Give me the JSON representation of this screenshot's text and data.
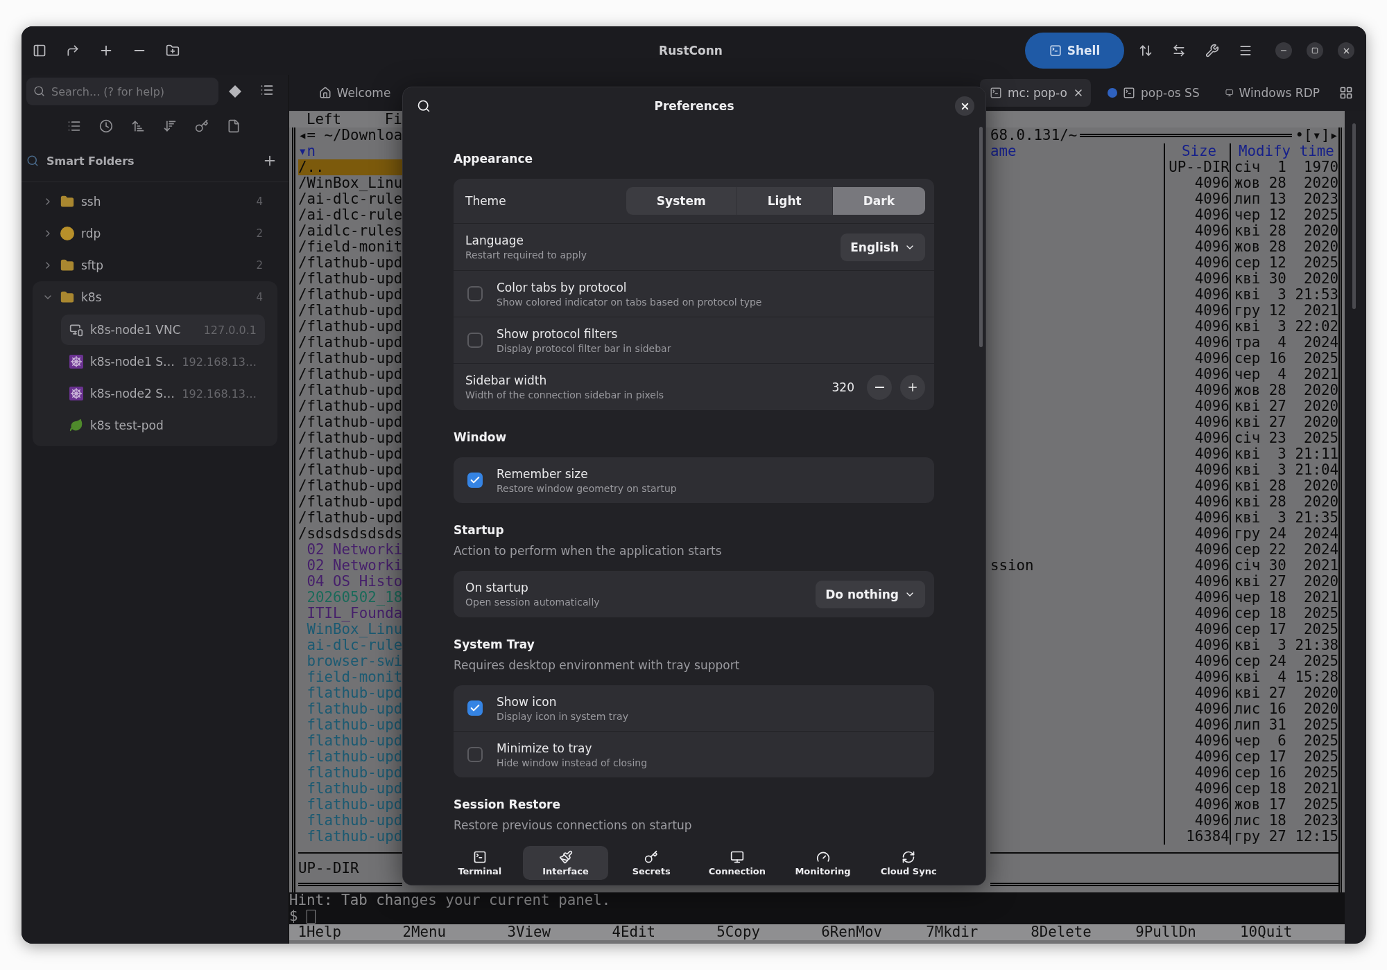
{
  "header": {
    "title": "RustConn",
    "shell_button": "Shell"
  },
  "sidebar": {
    "search": {
      "placeholder": "Search... (? for help)"
    },
    "smart_folders": {
      "title": "Smart Folders"
    },
    "tree": [
      {
        "label": "ssh",
        "count": "4",
        "kind": "folder",
        "expanded": false
      },
      {
        "label": "rdp",
        "count": "2",
        "kind": "emoji",
        "expanded": false
      },
      {
        "label": "sftp",
        "count": "2",
        "kind": "folder",
        "expanded": false
      },
      {
        "label": "k8s",
        "count": "4",
        "kind": "folder",
        "expanded": true,
        "children": [
          {
            "label": "k8s-node1 VNC",
            "host": "127.0.0.1",
            "kind": "vnc",
            "selected": true
          },
          {
            "label": "k8s-node1 S…",
            "host": "192.168.13…",
            "kind": "cluster",
            "selected": false
          },
          {
            "label": "k8s-node2 S…",
            "host": "192.168.13…",
            "kind": "cluster",
            "selected": false
          },
          {
            "label": "k8s test-pod",
            "kind": "pod",
            "selected": false
          }
        ]
      }
    ]
  },
  "tabs": [
    {
      "label": "Welcome",
      "kind": "home",
      "selected": false,
      "dot": false
    },
    {
      "label": "mc: pop-o",
      "kind": "terminal",
      "selected": true,
      "dot": false
    },
    {
      "label": "pop-os SS",
      "kind": "terminal",
      "selected": false,
      "dot": true
    },
    {
      "label": "Windows RDP",
      "kind": "remote",
      "selected": false,
      "dot": false
    }
  ],
  "terminal": {
    "menubar": [
      "Left",
      "Fi"
    ],
    "left_panel": {
      "path": "◂= ~/Downloa",
      "sort_header": "▾n",
      "status": "UP--DIR",
      "rows": [
        {
          "name": "/..",
          "kind": "updir",
          "selected": true
        },
        {
          "name": "/WinBox_Linu",
          "kind": "dir",
          "selected": false
        },
        {
          "name": "/ai-dlc-rule",
          "kind": "dir",
          "selected": false
        },
        {
          "name": "/ai-dlc-rule",
          "kind": "dir",
          "selected": false
        },
        {
          "name": "/aidlc-rules",
          "kind": "dir",
          "selected": false
        },
        {
          "name": "/field-monit",
          "kind": "dir",
          "selected": false
        },
        {
          "name": "/flathub-upd",
          "kind": "dir",
          "selected": false
        },
        {
          "name": "/flathub-upd",
          "kind": "dir",
          "selected": false
        },
        {
          "name": "/flathub-upd",
          "kind": "dir",
          "selected": false
        },
        {
          "name": "/flathub-upd",
          "kind": "dir",
          "selected": false
        },
        {
          "name": "/flathub-upd",
          "kind": "dir",
          "selected": false
        },
        {
          "name": "/flathub-upd",
          "kind": "dir",
          "selected": false
        },
        {
          "name": "/flathub-upd",
          "kind": "dir",
          "selected": false
        },
        {
          "name": "/flathub-upd",
          "kind": "dir",
          "selected": false
        },
        {
          "name": "/flathub-upd",
          "kind": "dir",
          "selected": false
        },
        {
          "name": "/flathub-upd",
          "kind": "dir",
          "selected": false
        },
        {
          "name": "/flathub-upd",
          "kind": "dir",
          "selected": false
        },
        {
          "name": "/flathub-upd",
          "kind": "dir",
          "selected": false
        },
        {
          "name": "/flathub-upd",
          "kind": "dir",
          "selected": false
        },
        {
          "name": "/flathub-upd",
          "kind": "dir",
          "selected": false
        },
        {
          "name": "/flathub-upd",
          "kind": "dir",
          "selected": false
        },
        {
          "name": "/flathub-upd",
          "kind": "dir",
          "selected": false
        },
        {
          "name": "/flathub-upd",
          "kind": "dir",
          "selected": false
        },
        {
          "name": "/sdsdsdsdsds",
          "kind": "dir",
          "selected": false
        },
        {
          "name": "02 Networki",
          "kind": "doc",
          "selected": false
        },
        {
          "name": "02 Networki",
          "kind": "doc",
          "selected": false
        },
        {
          "name": "04 OS Histo",
          "kind": "doc",
          "selected": false
        },
        {
          "name": "20260502_18",
          "kind": "media",
          "selected": false
        },
        {
          "name": "ITIL_Founda",
          "kind": "doc",
          "selected": false
        },
        {
          "name": "WinBox_Linu",
          "kind": "archive",
          "selected": false
        },
        {
          "name": "ai-dlc-rule",
          "kind": "archive",
          "selected": false
        },
        {
          "name": "browser-swi",
          "kind": "archive",
          "selected": false
        },
        {
          "name": "field-monit",
          "kind": "archive",
          "selected": false
        },
        {
          "name": "flathub-upd",
          "kind": "archive",
          "selected": false
        },
        {
          "name": "flathub-upd",
          "kind": "archive",
          "selected": false
        },
        {
          "name": "flathub-upd",
          "kind": "archive",
          "selected": false
        },
        {
          "name": "flathub-upd",
          "kind": "archive",
          "selected": false
        },
        {
          "name": "flathub-upd",
          "kind": "archive",
          "selected": false
        },
        {
          "name": "flathub-upd",
          "kind": "archive",
          "selected": false
        },
        {
          "name": "flathub-upd",
          "kind": "archive",
          "selected": false
        },
        {
          "name": "flathub-upd",
          "kind": "archive",
          "selected": false
        },
        {
          "name": "flathub-upd",
          "kind": "archive",
          "selected": false
        },
        {
          "name": "flathub-upd",
          "kind": "archive",
          "selected": false
        }
      ]
    },
    "right_panel": {
      "path": "68.0.131/~",
      "controls": "•[▾]▸",
      "columns": [
        "ame",
        "Size",
        "Modify time"
      ],
      "rows": [
        {
          "size": "UP--DIR",
          "date": "січ  1  1970"
        },
        {
          "size": "4096",
          "date": "жов 28  2020"
        },
        {
          "size": "4096",
          "date": "лип 13  2023"
        },
        {
          "size": "4096",
          "date": "чер 12  2025"
        },
        {
          "size": "4096",
          "date": "кві 28  2020"
        },
        {
          "size": "4096",
          "date": "жов 28  2020"
        },
        {
          "size": "4096",
          "date": "сер 12  2025"
        },
        {
          "size": "4096",
          "date": "кві 30  2020"
        },
        {
          "size": "4096",
          "date": "кві  3 21:53"
        },
        {
          "size": "4096",
          "date": "гру 12  2021"
        },
        {
          "size": "4096",
          "date": "кві  3 22:02"
        },
        {
          "size": "4096",
          "date": "тра  4  2024"
        },
        {
          "size": "4096",
          "date": "сер 16  2025"
        },
        {
          "size": "4096",
          "date": "чер  4  2021"
        },
        {
          "size": "4096",
          "date": "жов 28  2020"
        },
        {
          "size": "4096",
          "date": "кві 27  2020"
        },
        {
          "size": "4096",
          "date": "кві 27  2020"
        },
        {
          "size": "4096",
          "date": "січ 23  2025"
        },
        {
          "size": "4096",
          "date": "кві  3 21:11"
        },
        {
          "size": "4096",
          "date": "кві  3 21:04"
        },
        {
          "size": "4096",
          "date": "кві 28  2020"
        },
        {
          "size": "4096",
          "date": "кві 28  2020"
        },
        {
          "size": "4096",
          "date": "кві  3 21:35"
        },
        {
          "size": "4096",
          "date": "гру 24  2024"
        },
        {
          "size": "4096",
          "date": "сер 22  2024"
        },
        {
          "name": "ssion",
          "size": "4096",
          "date": "січ 30  2021"
        },
        {
          "size": "4096",
          "date": "кві 27  2020"
        },
        {
          "size": "4096",
          "date": "чер 18  2021"
        },
        {
          "size": "4096",
          "date": "сер 18  2025"
        },
        {
          "size": "4096",
          "date": "сер 17  2025"
        },
        {
          "size": "4096",
          "date": "кві  3 21:38"
        },
        {
          "size": "4096",
          "date": "сер 24  2025"
        },
        {
          "size": "4096",
          "date": "кві  4 15:28"
        },
        {
          "size": "4096",
          "date": "кві 27  2020"
        },
        {
          "size": "4096",
          "date": "лис 16  2020"
        },
        {
          "size": "4096",
          "date": "лип 31  2025"
        },
        {
          "size": "4096",
          "date": "чер  6  2025"
        },
        {
          "size": "4096",
          "date": "сер 17  2025"
        },
        {
          "size": "4096",
          "date": "сер 16  2025"
        },
        {
          "size": "4096",
          "date": "сер 18  2021"
        },
        {
          "size": "4096",
          "date": "жов 17  2025"
        },
        {
          "size": "4096",
          "date": "лис 18  2023"
        },
        {
          "size": "16384",
          "date": "гру 27 12:15"
        }
      ]
    },
    "hint": "Hint: Tab changes your current panel.",
    "prompt": "$",
    "keybar": [
      "1Help",
      "2Menu",
      "3View",
      "4Edit",
      "5Copy",
      "6RenMov",
      "7Mkdir",
      "8Delete",
      "9PullDn",
      "10Quit"
    ]
  },
  "preferences": {
    "title": "Preferences",
    "sections": [
      {
        "title": "Appearance",
        "rows": [
          {
            "kind": "segmented",
            "label": "Theme",
            "options": [
              {
                "label": "System",
                "selected": false
              },
              {
                "label": "Light",
                "selected": false
              },
              {
                "label": "Dark",
                "selected": true
              }
            ]
          },
          {
            "kind": "dropdown",
            "label": "Language",
            "subtitle": "Restart required to apply",
            "value": "English"
          },
          {
            "kind": "check",
            "label": "Color tabs by protocol",
            "subtitle": "Show colored indicator on tabs based on protocol type",
            "checked": false
          },
          {
            "kind": "check",
            "label": "Show protocol filters",
            "subtitle": "Display protocol filter bar in sidebar",
            "checked": false
          },
          {
            "kind": "spin",
            "label": "Sidebar width",
            "subtitle": "Width of the connection sidebar in pixels",
            "value": "320"
          }
        ]
      },
      {
        "title": "Window",
        "rows": [
          {
            "kind": "check",
            "label": "Remember size",
            "subtitle": "Restore window geometry on startup",
            "checked": true
          }
        ]
      },
      {
        "title": "Startup",
        "description": "Action to perform when the application starts",
        "rows": [
          {
            "kind": "dropdown",
            "label": "On startup",
            "subtitle": "Open session automatically",
            "value": "Do nothing"
          }
        ]
      },
      {
        "title": "System Tray",
        "description": "Requires desktop environment with tray support",
        "rows": [
          {
            "kind": "check",
            "label": "Show icon",
            "subtitle": "Display icon in system tray",
            "checked": true
          },
          {
            "kind": "check",
            "label": "Minimize to tray",
            "subtitle": "Hide window instead of closing",
            "checked": false
          }
        ]
      },
      {
        "title": "Session Restore",
        "description": "Restore previous connections on startup"
      }
    ],
    "nav": [
      {
        "label": "Terminal",
        "kind": "terminal",
        "selected": false
      },
      {
        "label": "Interface",
        "kind": "interface",
        "selected": true
      },
      {
        "label": "Secrets",
        "kind": "secrets",
        "selected": false
      },
      {
        "label": "Connection",
        "kind": "connection",
        "selected": false
      },
      {
        "label": "Monitoring",
        "kind": "monitoring",
        "selected": false
      },
      {
        "label": "Cloud Sync",
        "kind": "sync",
        "selected": false
      }
    ]
  }
}
